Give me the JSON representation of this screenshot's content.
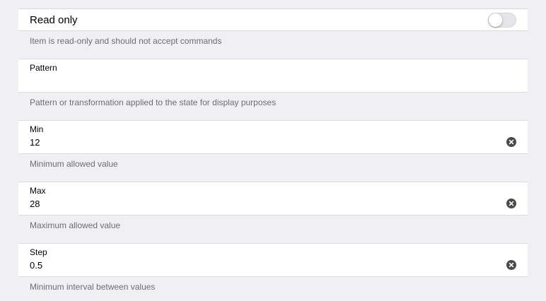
{
  "read_only": {
    "label": "Read only",
    "enabled": false,
    "help": "Item is read-only and should not accept commands"
  },
  "pattern": {
    "label": "Pattern",
    "value": "",
    "help": "Pattern or transformation applied to the state for display purposes"
  },
  "min": {
    "label": "Min",
    "value": "12",
    "help": "Minimum allowed value"
  },
  "max": {
    "label": "Max",
    "value": "28",
    "help": "Maximum allowed value"
  },
  "step": {
    "label": "Step",
    "value": "0.5",
    "help": "Minimum interval between values"
  },
  "icons": {
    "clear": "clear-circle-icon"
  }
}
